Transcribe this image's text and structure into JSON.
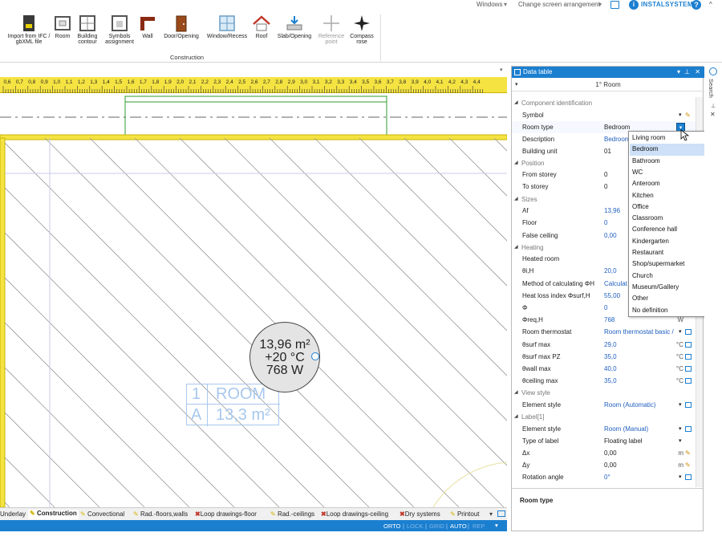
{
  "topbar": {
    "windows": "Windows",
    "change_arrangement": "Change screen arrangement",
    "brand": "INSTALSYSTEM",
    "help": "?"
  },
  "ribbon": {
    "buttons": [
      {
        "label": "Import from IFC / gbXML file",
        "icon": "ifc-import-icon"
      },
      {
        "label": "Room",
        "icon": "room-icon"
      },
      {
        "label": "Building contour",
        "icon": "building-contour-icon"
      },
      {
        "label": "Symbols assignment",
        "icon": "symbols-assignment-icon"
      },
      {
        "label": "Wall",
        "icon": "wall-icon"
      },
      {
        "label": "Door/Opening",
        "icon": "door-icon"
      },
      {
        "label": "Window/Recess",
        "icon": "window-icon"
      },
      {
        "label": "Roof",
        "icon": "roof-icon"
      },
      {
        "label": "Slab/Opening",
        "icon": "slab-icon"
      },
      {
        "label": "Reference point",
        "icon": "reference-point-icon"
      },
      {
        "label": "Compass rose",
        "icon": "compass-icon"
      }
    ],
    "group_label": "Construction"
  },
  "ruler": {
    "ticks": [
      "0,6",
      "0,7",
      "0,8",
      "0,9",
      "1,0",
      "1,1",
      "1,2",
      "1,3",
      "1,4",
      "1,5",
      "1,6",
      "1,7",
      "1,8",
      "1,9",
      "2,0",
      "2,1",
      "2,2",
      "2,3",
      "2,4",
      "2,5",
      "2,6",
      "2,7",
      "2,8",
      "2,9",
      "3,0",
      "3,1",
      "3,2",
      "3,3",
      "3,4",
      "3,5",
      "3,6",
      "3,7",
      "3,8",
      "3,9",
      "4,0",
      "4,1",
      "4,2",
      "4,3",
      "4,4"
    ]
  },
  "room_symbol": {
    "area": "13,96 m²",
    "temperature": "+20 °C",
    "heat": "768 W"
  },
  "room_label": {
    "number_prefix": "1",
    "name": "ROOM",
    "area_prefix": "A",
    "area": "13,3 m²"
  },
  "tabs": [
    "Underlay",
    "Construction",
    "Convectional",
    "Rad.-floors,walls",
    "Loop drawings-floor",
    "Rad.-ceilings",
    "Loop drawings-ceiling",
    "Dry systems",
    "Printout"
  ],
  "status": {
    "items": [
      "ORTO",
      "LOCK",
      "GRID",
      "AUTO",
      "REP"
    ]
  },
  "panel": {
    "title": "Data table",
    "room": "1° Room",
    "rows": [
      {
        "type": "sec",
        "label": "Component identification"
      },
      {
        "type": "row",
        "label": "Symbol",
        "value": ""
      },
      {
        "type": "row",
        "label": "Room type",
        "value": "Bedroom"
      },
      {
        "type": "row",
        "label": "Description",
        "value": "Bedroom",
        "blue": true
      },
      {
        "type": "row",
        "label": "Building unit",
        "value": "01"
      },
      {
        "type": "sec",
        "label": "Position"
      },
      {
        "type": "row",
        "label": "From storey",
        "value": "0"
      },
      {
        "type": "row",
        "label": "To storey",
        "value": "0"
      },
      {
        "type": "sec",
        "label": "Sizes"
      },
      {
        "type": "row",
        "label": "Af",
        "value": "13,96",
        "blue": true
      },
      {
        "type": "row",
        "label": "Floor",
        "value": "0",
        "blue": true
      },
      {
        "type": "row",
        "label": "False ceiling",
        "value": "0,00",
        "blue": true
      },
      {
        "type": "sec",
        "label": "Heating"
      },
      {
        "type": "row",
        "label": "Heated room",
        "value": ""
      },
      {
        "type": "row",
        "label": "θi,H",
        "value": "20,0",
        "blue": true
      },
      {
        "type": "row",
        "label": "Method of calculating ΦH",
        "value": "Calculat",
        "blue": true
      },
      {
        "type": "row",
        "label": "Heat loss index Φsurf,H",
        "value": "55,00",
        "blue": true
      },
      {
        "type": "row",
        "label": "Φ",
        "value": "0",
        "blue": true
      },
      {
        "type": "row",
        "label": "Φreq,H",
        "value": "768",
        "unit": "W",
        "blue": true
      },
      {
        "type": "row",
        "label": "Room thermostat",
        "value": "Room thermostat basic /",
        "blue": true
      },
      {
        "type": "row",
        "label": "θsurf max",
        "value": "29,0",
        "unit": "°C",
        "blue": true
      },
      {
        "type": "row",
        "label": "θsurf max PZ",
        "value": "35,0",
        "unit": "°C",
        "blue": true
      },
      {
        "type": "row",
        "label": "θwall max",
        "value": "40,0",
        "unit": "°C",
        "blue": true
      },
      {
        "type": "row",
        "label": "θceiling max",
        "value": "35,0",
        "unit": "°C",
        "blue": true
      },
      {
        "type": "sec",
        "label": "View style"
      },
      {
        "type": "row",
        "label": "Element style",
        "value": "Room (Automatic)",
        "blue": true
      },
      {
        "type": "sec",
        "label": "Label[1]"
      },
      {
        "type": "row",
        "label": "Element style",
        "value": "Room (Manual)",
        "blue": true
      },
      {
        "type": "row",
        "label": "Type of label",
        "value": "Floating label"
      },
      {
        "type": "row",
        "label": "Δx",
        "value": "0,00",
        "unit": "m"
      },
      {
        "type": "row",
        "label": "Δy",
        "value": "0,00",
        "unit": "m"
      },
      {
        "type": "row",
        "label": "Rotation angle",
        "value": "0°",
        "blue": true
      }
    ],
    "help_title": "Room type"
  },
  "dropdown": {
    "options": [
      "Living room",
      "Bedroom",
      "Bathroom",
      "WC",
      "Anteroom",
      "Kitchen",
      "Office",
      "Classroom",
      "Conference hall",
      "Kindergarten",
      "Restaurant",
      "Shop/supermarket",
      "Church",
      "Museum/Gallery",
      "Other",
      "No definition"
    ],
    "selected": "Bedroom"
  },
  "search_strip": {
    "label": "Search"
  },
  "colors": {
    "accent": "#1b7fd0",
    "ruler": "#f5e342",
    "selected": "#cde0f7",
    "value_blue": "#1f5fbf"
  }
}
